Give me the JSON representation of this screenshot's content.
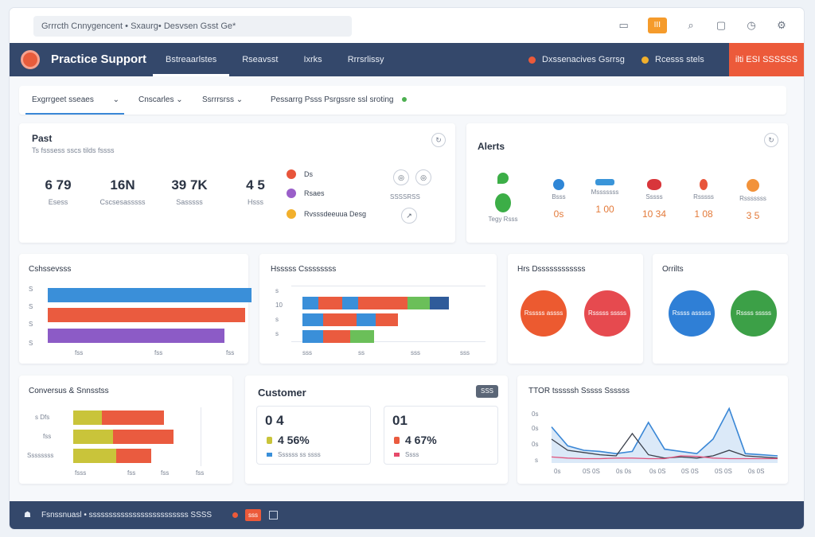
{
  "browser": {
    "url": "Grrrcth Cnnygencent • Sxaurg• Desvsen Gsst Ge*",
    "icons": [
      "chat-icon",
      "badge",
      "search-icon",
      "page-icon",
      "clock-icon",
      "settings-icon"
    ],
    "badge_label": "III"
  },
  "nav": {
    "brand": "Practice Support",
    "tabs": [
      "Bstreaarlstes",
      "Rseavsst",
      "Ixrks",
      "Rrrsrlissy"
    ],
    "status_1": "Dxssenacives Gsrrsg",
    "status_2": "Rcesss stels",
    "cta": "ilti ESI SSSSSS",
    "colors": {
      "bar": "#34486b",
      "cta": "#ec5a3a"
    }
  },
  "filters": {
    "f1": "Exgrrgeet sseaes",
    "f2": "Cnscarles",
    "f3": "Ssrrrsrss",
    "f4": "Pessarrg Psss Psrgssre ssl sroting"
  },
  "past": {
    "title": "Past",
    "subtitle": "Ts fsssess sscs tilds fssss",
    "kpis": [
      {
        "value": "6 79",
        "label": "Esess"
      },
      {
        "value": "16N",
        "label": "Cscsesasssss"
      },
      {
        "value": "39 7K",
        "label": "Sasssss"
      },
      {
        "value": "4 5",
        "label": "Hsss"
      }
    ],
    "legend": [
      {
        "label": "Ds",
        "color": "#e8553b"
      },
      {
        "label": "Rsaes",
        "color": "#9a5fc9"
      },
      {
        "label": "Rvsssdeeuua Desg",
        "color": "#f2b02c"
      }
    ],
    "side_label": "SSSSRSS"
  },
  "alerts": {
    "title": "Alerts",
    "items": [
      {
        "label": "Tegy Rsss",
        "value": "",
        "color": "#3cae47"
      },
      {
        "label": "Bsss",
        "value": "0s",
        "color": "#2f86d6"
      },
      {
        "label": "Msssssss",
        "value": "1 00",
        "color": "#3a95d9"
      },
      {
        "label": "Sssss",
        "value": "10 34",
        "color": "#d8363b"
      },
      {
        "label": "Rsssss",
        "value": "1 08",
        "color": "#e8553b"
      },
      {
        "label": "Rsssssss",
        "value": "3 5",
        "color": "#f2923a"
      }
    ]
  },
  "chart1": {
    "title": "Cshssevsss",
    "row_labels": [
      "S",
      "S",
      "S",
      "S"
    ],
    "axis_labels": [
      "",
      "fss",
      "fss",
      "fss"
    ]
  },
  "chart2": {
    "title": "Hsssss Cssssssss",
    "row_labels": [
      "s",
      "10",
      "s",
      "s"
    ],
    "axis_labels": [
      "sss",
      "ss",
      "sss",
      "sss"
    ]
  },
  "rates": {
    "title": "Hrs Dssssssssssss",
    "c1": "Rsssss assss",
    "c2": "Rsssss sssss"
  },
  "offline": {
    "title": "Orrilts",
    "c1": "Rssss asssss",
    "c2": "Rssss sssss"
  },
  "channels": {
    "title": "Conversus & Snnsstss",
    "row_labels": [
      "s Dfs",
      "fss",
      "Ssssssss"
    ],
    "axis_labels": [
      "fsss",
      "fss",
      "fss",
      "fss"
    ]
  },
  "customer": {
    "title": "Customer",
    "chip": "SSS",
    "box1": {
      "big": "0 4",
      "pct": "4 56%",
      "sub": "Ssssss ss ssss"
    },
    "box2": {
      "big": "01",
      "pct": "4 67%",
      "sub": "Ssss"
    }
  },
  "trend": {
    "title": "TTOR tsssssh Sssss Ssssss",
    "y_labels": [
      "0s",
      "0s",
      "0s",
      "s"
    ],
    "x_labels": [
      "0s",
      "0S 0S",
      "0s 0s",
      "0s 0S",
      "0S 0S",
      "0S 0S",
      "0s 0S"
    ]
  },
  "chart_data": {
    "type": "line",
    "title": "TTOR tsssssh Sssss Ssssss",
    "x": [
      0,
      1,
      2,
      3,
      4,
      5,
      6,
      7,
      8,
      9,
      10,
      11,
      12,
      13,
      14
    ],
    "series": [
      {
        "name": "",
        "values": [
          62,
          28,
          20,
          18,
          14,
          18,
          70,
          22,
          18,
          14,
          40,
          95,
          14,
          12,
          10
        ]
      },
      {
        "name": "",
        "values": [
          40,
          20,
          16,
          12,
          10,
          50,
          12,
          6,
          8,
          6,
          10,
          20,
          10,
          8,
          6
        ]
      },
      {
        "name": "",
        "values": [
          8,
          6,
          5,
          5,
          6,
          6,
          5,
          5,
          10,
          9,
          6,
          5,
          5,
          5,
          5
        ]
      }
    ],
    "ylim": [
      0,
      100
    ]
  },
  "footer": {
    "text": "Fsnssnuasl • sssssssssssssssssssssssss SSSS",
    "badge": "sss"
  }
}
